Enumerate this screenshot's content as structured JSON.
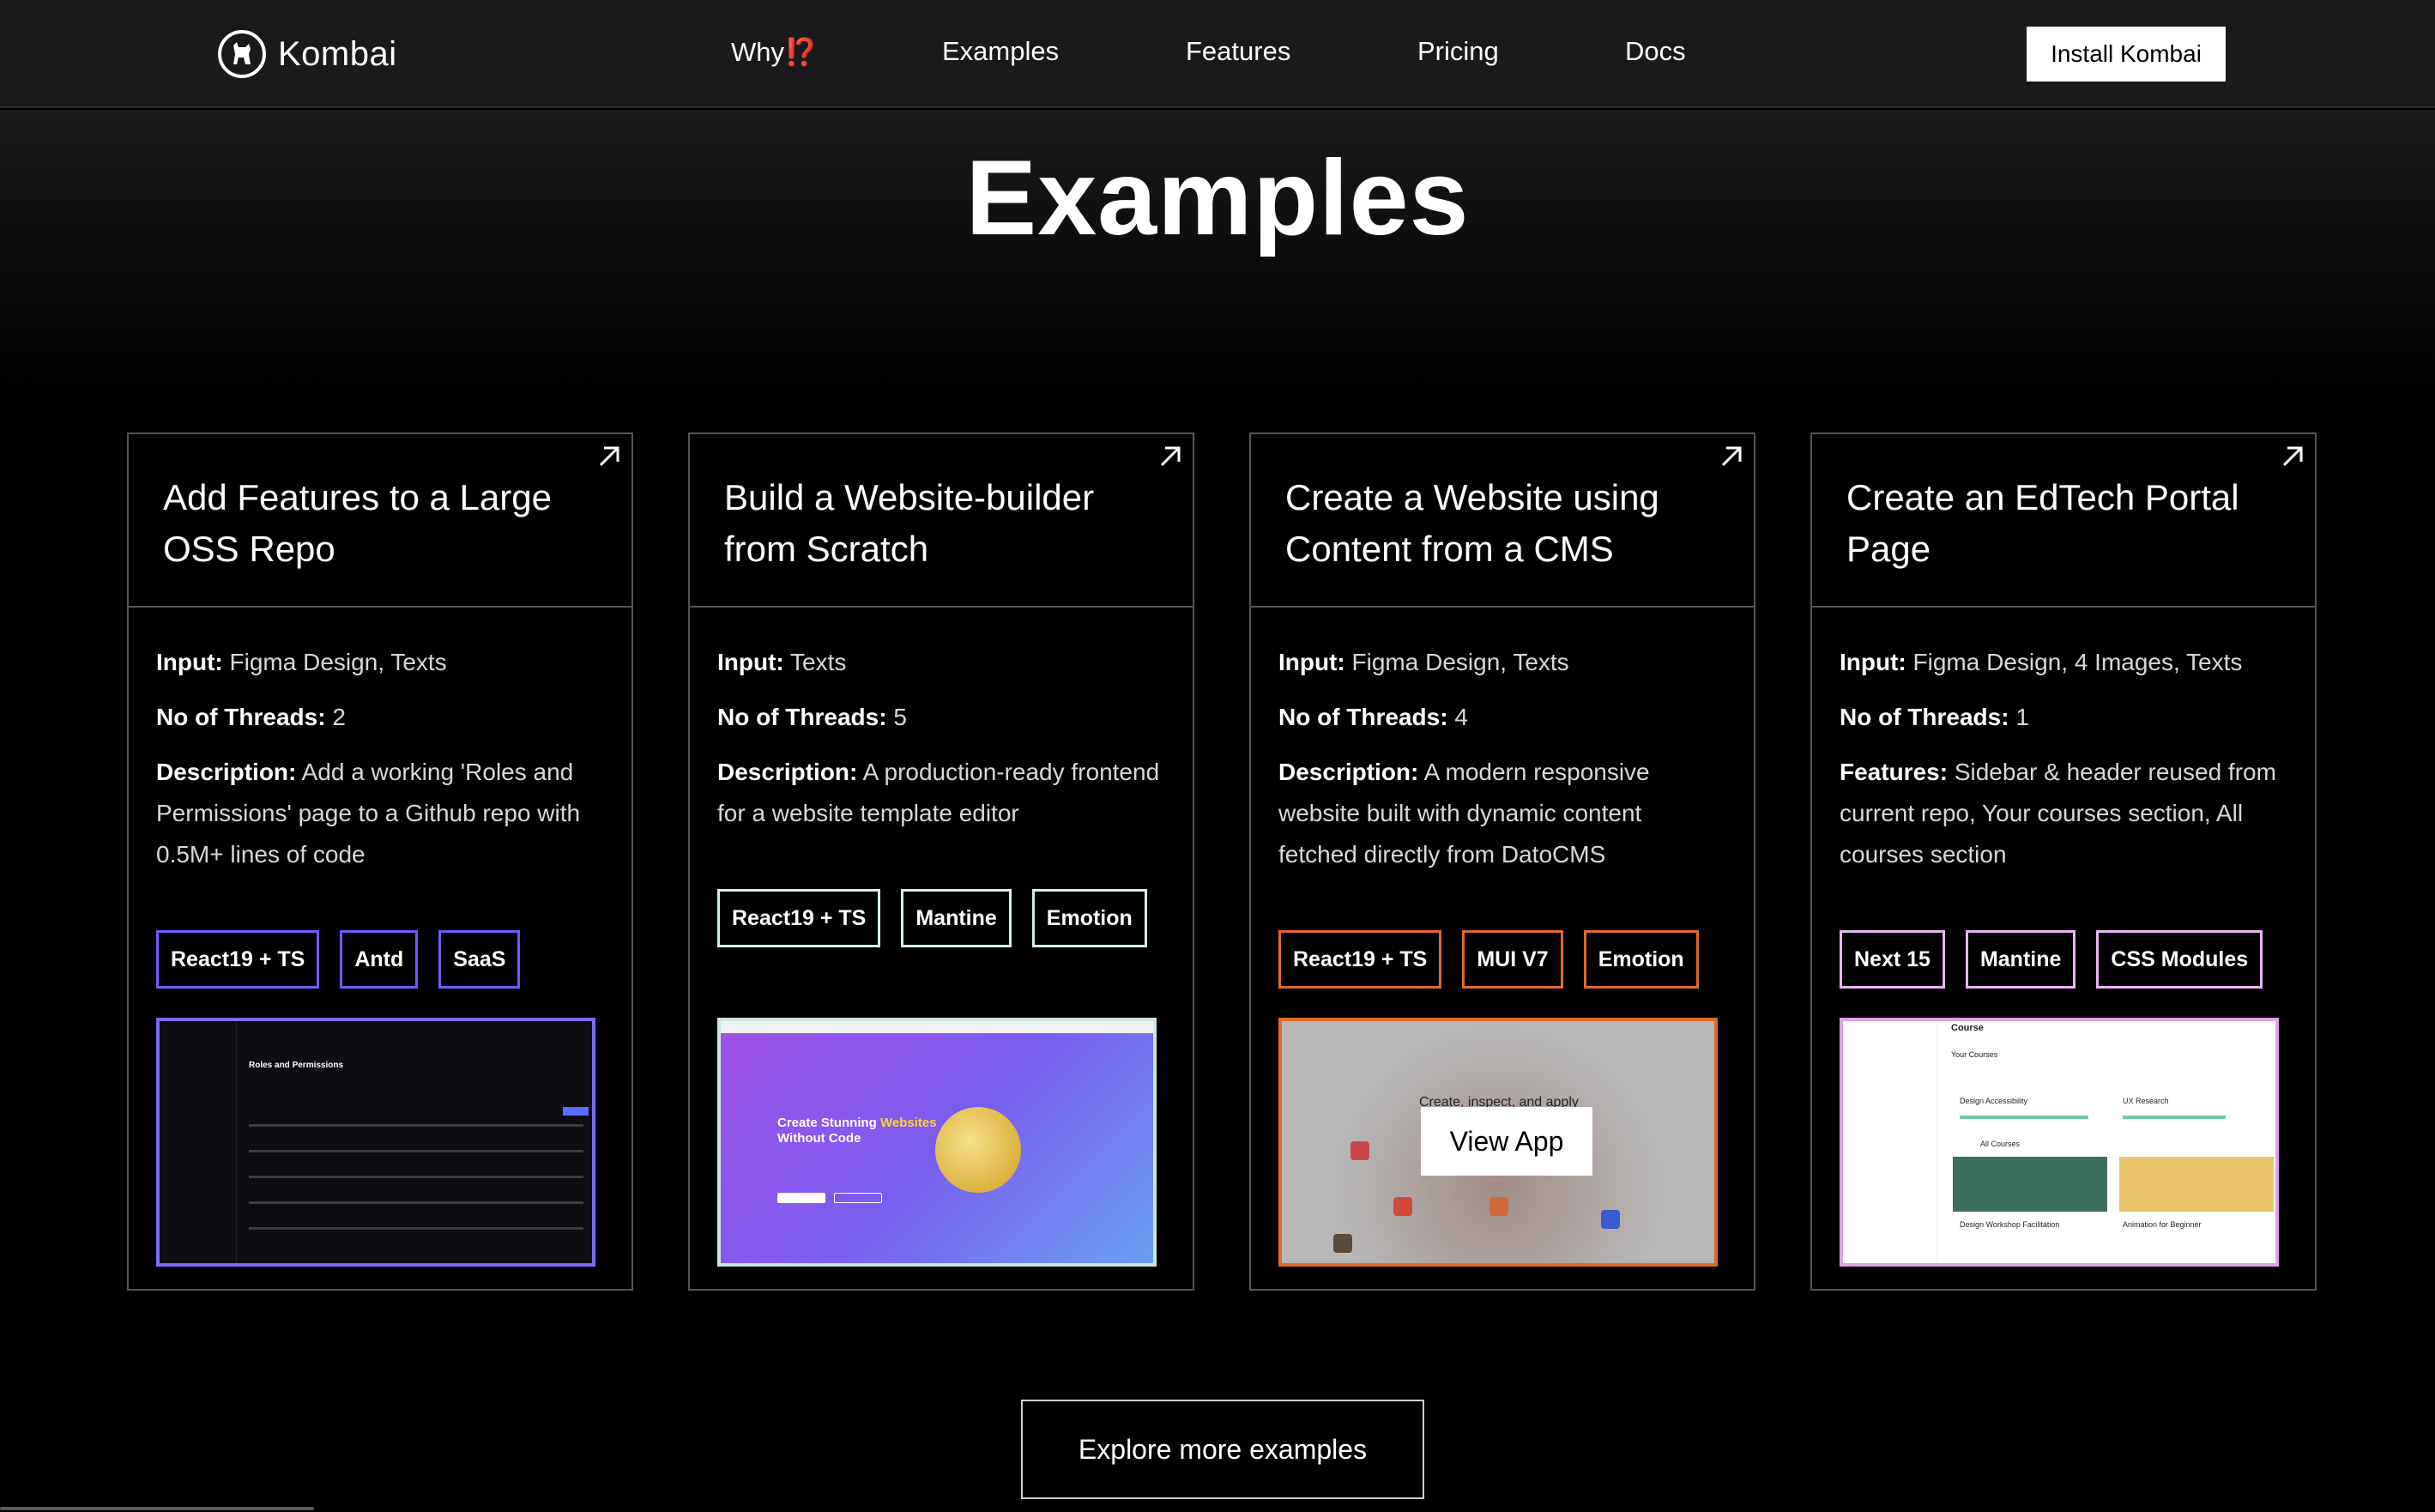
{
  "nav": {
    "brand": "Kombai",
    "links": [
      {
        "label": "Why",
        "emph": "⁉️"
      },
      {
        "label": "Examples"
      },
      {
        "label": "Features"
      },
      {
        "label": "Pricing"
      },
      {
        "label": "Docs"
      }
    ],
    "cta": "Install Kombai"
  },
  "page": {
    "title": "Examples",
    "explore": "Explore more examples"
  },
  "cards": [
    {
      "title": "Add Features to a Large OSS Repo",
      "rows": [
        {
          "k": "Input:",
          "v": " Figma Design, Texts"
        },
        {
          "k": "No of Threads:",
          "v": " 2"
        },
        {
          "k": "Description:",
          "v": " Add a working 'Roles and Permissions' page to a Github repo with 0.5M+ lines of code"
        }
      ],
      "tags": [
        "React19 + TS",
        "Antd",
        "SaaS"
      ],
      "tag_color": "#6f5cff",
      "shot": {
        "title": "Roles and Permissions"
      }
    },
    {
      "title": "Build a Website-builder from Scratch",
      "rows": [
        {
          "k": "Input:",
          "v": " Texts"
        },
        {
          "k": "No of Threads:",
          "v": " 5"
        },
        {
          "k": "Description:",
          "v": " A production-ready frontend for a website template editor"
        }
      ],
      "tags": [
        "React19 + TS",
        "Mantine",
        "Emotion"
      ],
      "tag_color": "#d6efe6",
      "shot": {
        "headline_a": "Create Stunning ",
        "headline_b": "Websites",
        "headline_c": "Without Code"
      }
    },
    {
      "title": "Create a Website using Content from a CMS",
      "rows": [
        {
          "k": "Input:",
          "v": " Figma Design, Texts"
        },
        {
          "k": "No of Threads:",
          "v": " 4"
        },
        {
          "k": "Description:",
          "v": " A modern responsive website built with dynamic content fetched directly from DatoCMS"
        }
      ],
      "tags": [
        "React19 + TS",
        "MUI V7",
        "Emotion"
      ],
      "tag_color": "#e06a2a",
      "shot": {
        "button": "View App",
        "caption": "Create, inspect, and apply"
      }
    },
    {
      "title": "Create an EdTech Portal Page",
      "rows": [
        {
          "k": "Input:",
          "v": " Figma Design, 4 Images, Texts"
        },
        {
          "k": "No of Threads:",
          "v": " 1"
        },
        {
          "k": "Features:",
          "v": " Sidebar & header reused from current repo, Your courses section, All courses section"
        }
      ],
      "tags": [
        "Next 15",
        "Mantine",
        "CSS Modules"
      ],
      "tag_color": "#e8b6f0",
      "shot": {
        "heading": "Course",
        "sub": "Your Courses",
        "all": "All Courses",
        "c1": "Design Accessibility",
        "c2": "UX Research",
        "c3": "Design Workshop Facilitation",
        "c4": "Animation for Beginner"
      }
    }
  ],
  "colors": {
    "accent_red": "#ff3b3b",
    "background": "#000000"
  }
}
